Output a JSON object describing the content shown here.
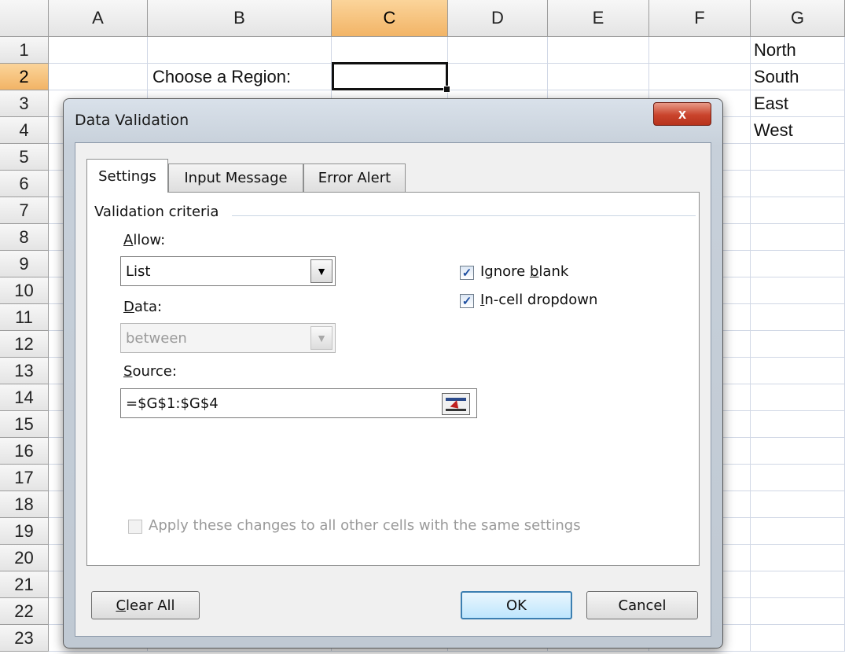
{
  "sheet": {
    "columns": [
      "A",
      "B",
      "C",
      "D",
      "E",
      "F",
      "G"
    ],
    "selected_column": "C",
    "rows": [
      "1",
      "2",
      "3",
      "4",
      "5",
      "6",
      "7",
      "8",
      "9",
      "10",
      "11",
      "12",
      "13",
      "14",
      "15",
      "16",
      "17",
      "18",
      "19",
      "20",
      "21",
      "22",
      "23"
    ],
    "selected_row": "2",
    "cells": {
      "b2": "Choose a Region:",
      "g1": "North",
      "g2": "South",
      "g3": "East",
      "g4": "West"
    }
  },
  "dialog": {
    "title": "Data Validation",
    "close_label": "x",
    "tabs": [
      "Settings",
      "Input Message",
      "Error Alert"
    ],
    "active_tab": "Settings",
    "group_label": "Validation criteria",
    "allow_label_u": "A",
    "allow_label_rest": "llow:",
    "allow_value": "List",
    "data_label_u": "D",
    "data_label_rest": "ata:",
    "data_value": "between",
    "source_label_u": "S",
    "source_label_rest": "ource:",
    "source_value": "=$G$1:$G$4",
    "ignore_blank_pre": "Ignore ",
    "ignore_blank_u": "b",
    "ignore_blank_post": "lank",
    "ignore_blank_checked": true,
    "incell_u": "I",
    "incell_rest": "n-cell dropdown",
    "incell_checked": true,
    "apply_label": "Apply these changes to all other cells with the same settings",
    "apply_checked": false,
    "clear_u": "C",
    "clear_rest": "lear All",
    "ok_label": "OK",
    "cancel_label": "Cancel"
  },
  "icons": {
    "dropdown": "chevron-down-icon",
    "checkmark": "check-icon",
    "range_picker": "collapse-dialog-icon"
  }
}
